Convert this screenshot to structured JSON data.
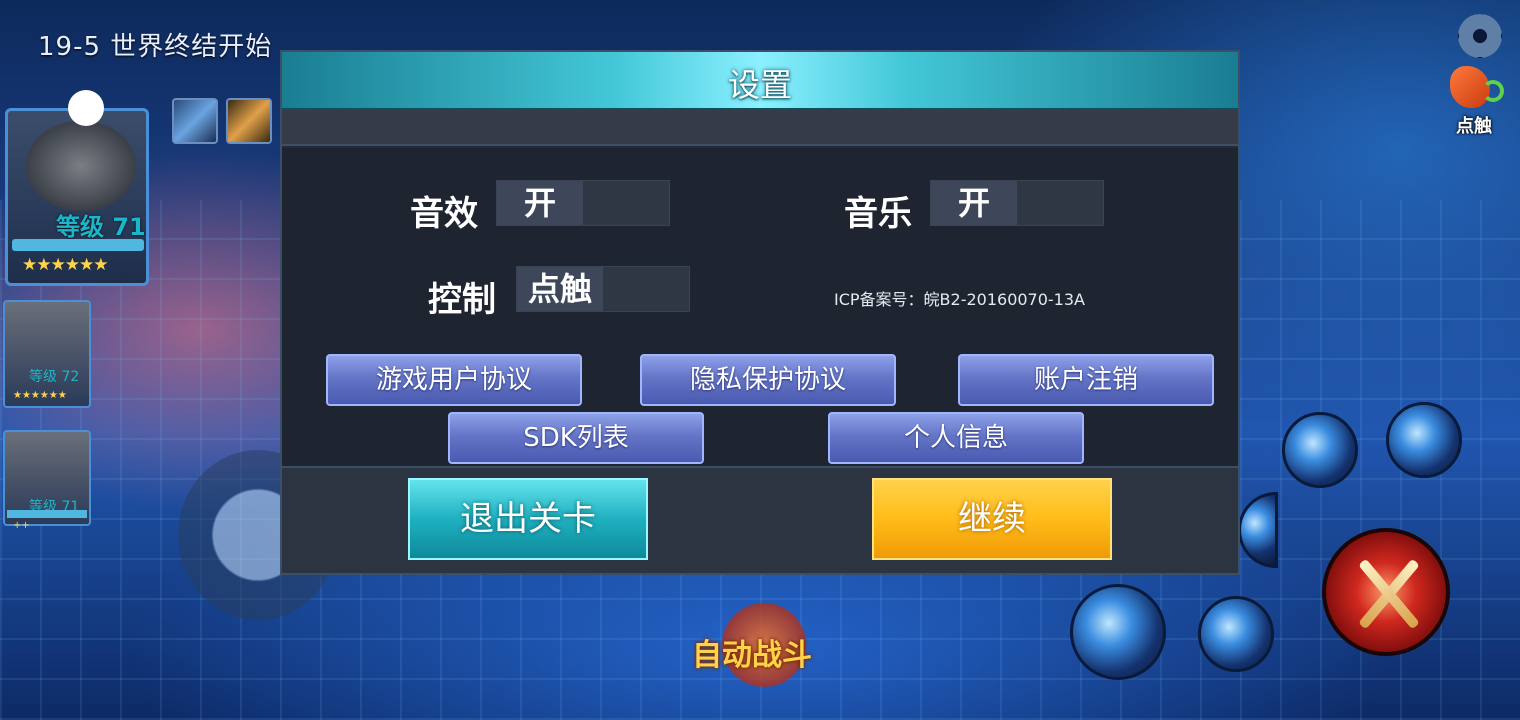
{
  "hud": {
    "level_title": "19-5 世界终结开始",
    "touch_mode_label": "点触",
    "auto_battle_label": "自动战斗"
  },
  "heroes": [
    {
      "level": "等级 71",
      "stars": "★★★★★★"
    },
    {
      "level": "等级 72",
      "stars": "★★★★★★"
    },
    {
      "level": "等级 71",
      "stars": "++"
    }
  ],
  "dialog": {
    "title": "设置",
    "sound_effect": {
      "label": "音效",
      "value": "开"
    },
    "music": {
      "label": "音乐",
      "value": "开"
    },
    "control": {
      "label": "控制",
      "value": "点触"
    },
    "icp": "ICP备案号：皖B2-20160070-13A",
    "buttons": {
      "user_agreement": "游戏用户协议",
      "privacy_agreement": "隐私保护协议",
      "account_cancel": "账户注销",
      "sdk_list": "SDK列表",
      "personal_info": "个人信息"
    },
    "exit_label": "退出关卡",
    "continue_label": "继续"
  },
  "colors": {
    "dialog_bg": "#232a38",
    "header_accent": "#43c8d8",
    "blue_button": "#6475c8",
    "exit_button": "#1fb0c0",
    "continue_button": "#ffbc18"
  }
}
